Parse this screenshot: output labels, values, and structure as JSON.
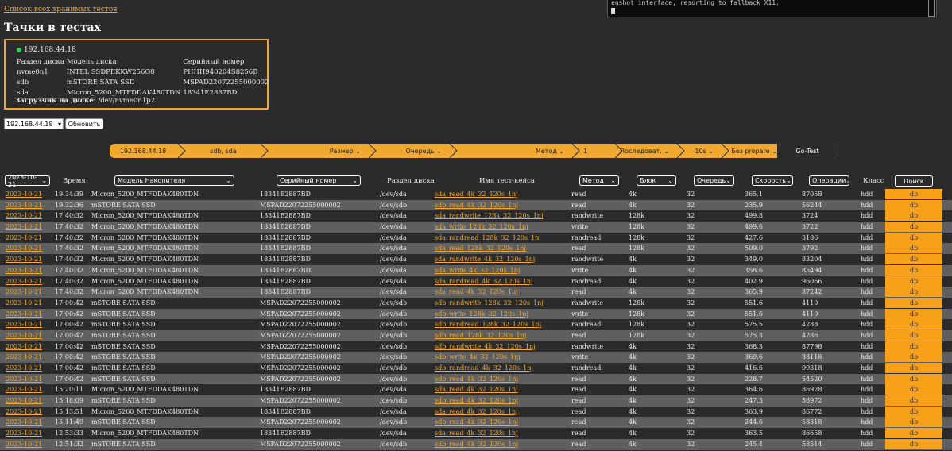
{
  "top_link": "Список всех хранимых тестов",
  "page_title": "Тачки в тестах",
  "terminal_text": "enshot interface, resorting to fallback X11.",
  "machine": {
    "ip": "192.168.44.18",
    "status_color": "#2ecc40",
    "headers": [
      "Раздел диска",
      "Модель диска",
      "Серийный номер"
    ],
    "disks": [
      [
        "nvme0n1",
        "INTEL SSDPEKKW256G8",
        "PHHH940204S8256B"
      ],
      [
        "sdb",
        "mSTORE SATA SSD",
        "MSPAD22072255000002"
      ],
      [
        "sda",
        "Micron_5200_MTFDDAK480TDN",
        "18341E2887BD"
      ]
    ],
    "loader_label": "Загрузчик на диске:",
    "loader_value": "/dev/nvme0n1p2"
  },
  "controls": {
    "ip_select_value": "192.168.44.18",
    "refresh_label": "Обновить"
  },
  "pipeline": {
    "ip": "192.168.44.18",
    "disks": "sdb, sda",
    "size": "Размер",
    "queue": "Очередь",
    "method": "Метод",
    "block": "1",
    "sequence": "Последоват.",
    "duration": "10s",
    "prepare": "Без prepare",
    "go": "Go-Test"
  },
  "filters": {
    "date": "2023-10-21",
    "time_label": "Время",
    "model": "Модель Накопителя",
    "serial": "Серийный номер",
    "partition_label": "Раздел диска",
    "testcase_label": "Имя тест-кейса",
    "method": "Метод",
    "block": "Блок",
    "queue": "Очередь",
    "speed": "Скорость",
    "ops": "Операции",
    "class_label": "Класс",
    "search": "Поиск"
  },
  "accent_color": "#f0a92e",
  "action_label": "db",
  "rows": [
    [
      "2023-10-21",
      "19:34:39",
      "Micron_5200_MTFDDAK480TDN",
      "18341E2887BD",
      "/dev/sda",
      "sda_read_4k_32_120s_1nj",
      "read",
      "4k",
      "32",
      "365.1",
      "87058",
      "hdd"
    ],
    [
      "2023-10-21",
      "19:32:36",
      "mSTORE SATA SSD",
      "MSPAD22072255000002",
      "/dev/sdb",
      "sdb_read_4k_32_120s_1nj",
      "read",
      "4k",
      "32",
      "235.9",
      "56244",
      "hdd"
    ],
    [
      "2023-10-21",
      "17:40:32",
      "Micron_5200_MTFDDAK480TDN",
      "18341E2887BD",
      "/dev/sda",
      "sda_randwrite_128k_32_120s_1nj",
      "randwrite",
      "128k",
      "32",
      "499.8",
      "3724",
      "hdd"
    ],
    [
      "2023-10-21",
      "17:40:32",
      "Micron_5200_MTFDDAK480TDN",
      "18341E2887BD",
      "/dev/sda",
      "sda_write_128k_32_120s_1nj",
      "write",
      "128k",
      "32",
      "499.6",
      "3722",
      "hdd"
    ],
    [
      "2023-10-21",
      "17:40:32",
      "Micron_5200_MTFDDAK480TDN",
      "18341E2887BD",
      "/dev/sda",
      "sda_randread_128k_32_120s_1nj",
      "randread",
      "128k",
      "32",
      "427.6",
      "3186",
      "hdd"
    ],
    [
      "2023-10-21",
      "17:40:32",
      "Micron_5200_MTFDDAK480TDN",
      "18341E2887BD",
      "/dev/sda",
      "sda_read_128k_32_120s_1nj",
      "read",
      "128k",
      "32",
      "509.0",
      "3792",
      "hdd"
    ],
    [
      "2023-10-21",
      "17:40:32",
      "Micron_5200_MTFDDAK480TDN",
      "18341E2887BD",
      "/dev/sda",
      "sda_randwrite_4k_32_120s_1nj",
      "randwrite",
      "4k",
      "32",
      "349.0",
      "83204",
      "hdd"
    ],
    [
      "2023-10-21",
      "17:40:32",
      "Micron_5200_MTFDDAK480TDN",
      "18341E2887BD",
      "/dev/sda",
      "sda_write_4k_32_120s_1nj",
      "write",
      "4k",
      "32",
      "358.6",
      "85494",
      "hdd"
    ],
    [
      "2023-10-21",
      "17:40:32",
      "Micron_5200_MTFDDAK480TDN",
      "18341E2887BD",
      "/dev/sda",
      "sda_randread_4k_32_120s_1nj",
      "randread",
      "4k",
      "32",
      "402.9",
      "96066",
      "hdd"
    ],
    [
      "2023-10-21",
      "17:40:32",
      "Micron_5200_MTFDDAK480TDN",
      "18341E2887BD",
      "/dev/sda",
      "sda_read_4k_32_120s_1nj",
      "read",
      "4k",
      "32",
      "365.9",
      "87242",
      "hdd"
    ],
    [
      "2023-10-21",
      "17:00:42",
      "mSTORE SATA SSD",
      "MSPAD22072255000002",
      "/dev/sdb",
      "sdb_randwrite_128k_32_120s_1nj",
      "randwrite",
      "128k",
      "32",
      "551.6",
      "4110",
      "hdd"
    ],
    [
      "2023-10-21",
      "17:00:42",
      "mSTORE SATA SSD",
      "MSPAD22072255000002",
      "/dev/sdb",
      "sdb_write_128k_32_120s_1nj",
      "write",
      "128k",
      "32",
      "551.6",
      "4110",
      "hdd"
    ],
    [
      "2023-10-21",
      "17:00:42",
      "mSTORE SATA SSD",
      "MSPAD22072255000002",
      "/dev/sdb",
      "sdb_randread_128k_32_120s_1nj",
      "randread",
      "128k",
      "32",
      "575.5",
      "4288",
      "hdd"
    ],
    [
      "2023-10-21",
      "17:00:42",
      "mSTORE SATA SSD",
      "MSPAD22072255000002",
      "/dev/sdb",
      "sdb_read_128k_32_120s_1nj",
      "read",
      "128k",
      "32",
      "575.3",
      "4286",
      "hdd"
    ],
    [
      "2023-10-21",
      "17:00:42",
      "mSTORE SATA SSD",
      "MSPAD22072255000002",
      "/dev/sdb",
      "sdb_randwrite_4k_32_120s_1nj",
      "randwrite",
      "4k",
      "32",
      "368.3",
      "87798",
      "hdd"
    ],
    [
      "2023-10-21",
      "17:00:42",
      "mSTORE SATA SSD",
      "MSPAD22072255000002",
      "/dev/sdb",
      "sdb_write_4k_32_120s_1nj",
      "write",
      "4k",
      "32",
      "369.6",
      "88118",
      "hdd"
    ],
    [
      "2023-10-21",
      "17:00:42",
      "mSTORE SATA SSD",
      "MSPAD22072255000002",
      "/dev/sdb",
      "sdb_randread_4k_32_120s_1nj",
      "randread",
      "4k",
      "32",
      "416.6",
      "99318",
      "hdd"
    ],
    [
      "2023-10-21",
      "17:00:42",
      "mSTORE SATA SSD",
      "MSPAD22072255000002",
      "/dev/sdb",
      "sdb_read_4k_32_120s_1nj",
      "read",
      "4k",
      "32",
      "228.7",
      "54520",
      "hdd"
    ],
    [
      "2023-10-21",
      "15:20:11",
      "Micron_5200_MTFDDAK480TDN",
      "18341E2887BD",
      "/dev/sda",
      "sda_read_4k_32_120s_1nj",
      "read",
      "4k",
      "32",
      "364.6",
      "86928",
      "hdd"
    ],
    [
      "2023-10-21",
      "15:18:09",
      "mSTORE SATA SSD",
      "MSPAD22072255000002",
      "/dev/sdb",
      "sdb_read_4k_32_120s_1nj",
      "read",
      "4k",
      "32",
      "247.3",
      "58972",
      "hdd"
    ],
    [
      "2023-10-21",
      "15:13:51",
      "Micron_5200_MTFDDAK480TDN",
      "18341E2887BD",
      "/dev/sda",
      "sda_read_4k_32_120s_1nj",
      "read",
      "4k",
      "32",
      "363.9",
      "86772",
      "hdd"
    ],
    [
      "2023-10-21",
      "15:11:49",
      "mSTORE SATA SSD",
      "MSPAD22072255000002",
      "/dev/sdb",
      "sdb_read_4k_32_120s_1nj",
      "read",
      "4k",
      "32",
      "244.6",
      "58318",
      "hdd"
    ],
    [
      "2023-10-21",
      "12:53:33",
      "Micron_5200_MTFDDAK480TDN",
      "18341E2887BD",
      "/dev/sda",
      "sda_read_4k_32_120s_1nj",
      "read",
      "4k",
      "32",
      "363.5",
      "86658",
      "hdd"
    ],
    [
      "2023-10-21",
      "12:51:32",
      "mSTORE SATA SSD",
      "MSPAD22072255000002",
      "/dev/sdb",
      "sdb_read_4k_32_120s_1nj",
      "read",
      "4k",
      "32",
      "245.4",
      "58514",
      "hdd"
    ]
  ]
}
